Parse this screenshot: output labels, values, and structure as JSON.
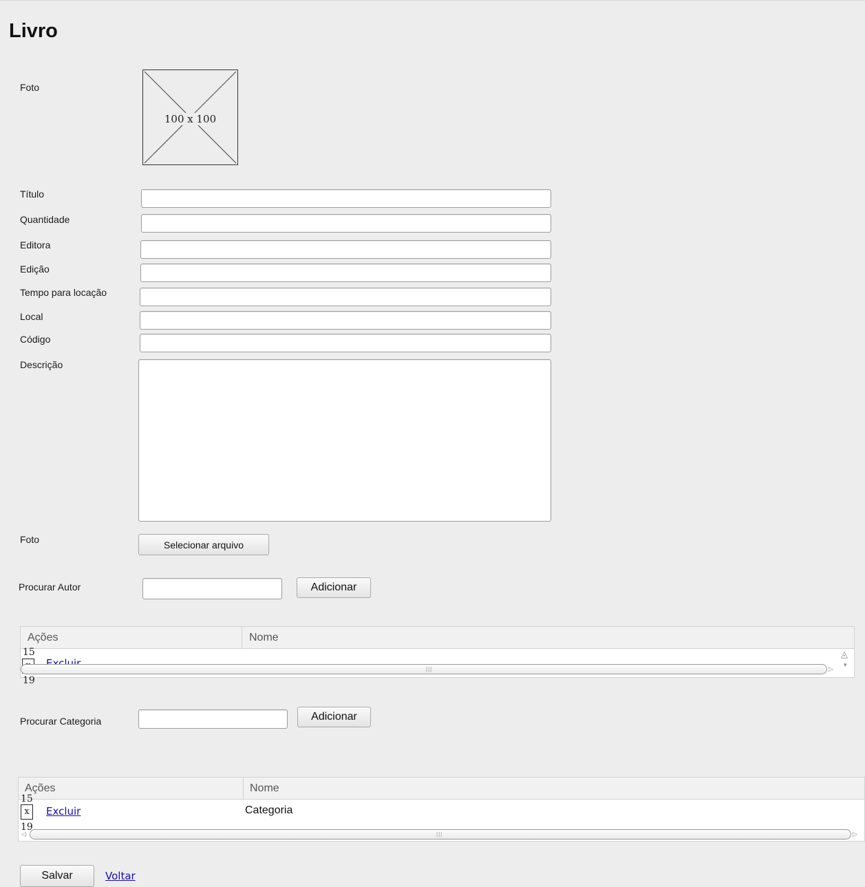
{
  "page": {
    "title": "Livro"
  },
  "photo": {
    "label": "Foto",
    "placeholder_text": "100 x 100"
  },
  "fields": {
    "titulo": {
      "label": "Título",
      "value": ""
    },
    "quantidade": {
      "label": "Quantidade",
      "value": ""
    },
    "editora": {
      "label": "Editora",
      "value": ""
    },
    "edicao": {
      "label": "Edição",
      "value": ""
    },
    "tempo": {
      "label": "Tempo para locação",
      "value": ""
    },
    "local": {
      "label": "Local",
      "value": ""
    },
    "codigo": {
      "label": "Código",
      "value": ""
    },
    "descricao": {
      "label": "Descrição",
      "value": ""
    }
  },
  "upload": {
    "label": "Foto",
    "button_label": "Selecionar arquivo"
  },
  "autor": {
    "search_label": "Procurar Autor",
    "add_label": "Adicionar",
    "columns": [
      "Ações",
      "Nome"
    ],
    "rows": [
      {
        "num_top": "15",
        "icon": "x",
        "action": "Excluir",
        "num_bottom": "19",
        "name": ""
      }
    ]
  },
  "categoria": {
    "search_label": "Procurar Categoria",
    "add_label": "Adicionar",
    "columns": [
      "Ações",
      "Nome"
    ],
    "rows": [
      {
        "num_top": "15",
        "icon": "x",
        "action": "Excluir",
        "num_bottom": "19",
        "name": "Categoria"
      }
    ]
  },
  "footer": {
    "save_label": "Salvar",
    "back_label": "Voltar"
  },
  "icons": {
    "photo_placeholder": "image-placeholder-icon",
    "remove": "x-icon"
  }
}
